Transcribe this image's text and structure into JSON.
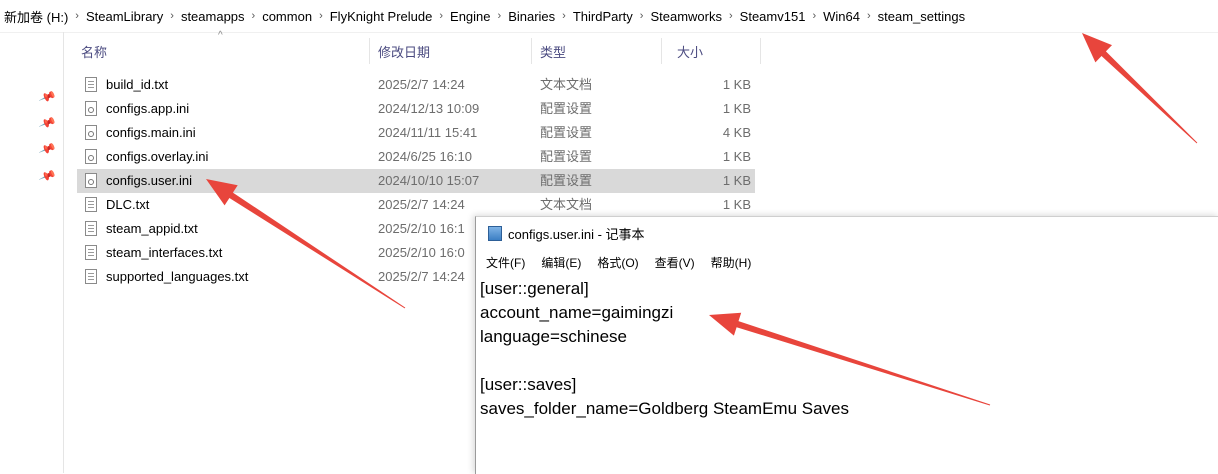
{
  "breadcrumb": [
    "新加卷 (H:)",
    "SteamLibrary",
    "steamapps",
    "common",
    "FlyKnight Prelude",
    "Engine",
    "Binaries",
    "ThirdParty",
    "Steamworks",
    "Steamv151",
    "Win64",
    "steam_settings"
  ],
  "columns": {
    "name": "名称",
    "date": "修改日期",
    "type": "类型",
    "size": "大小"
  },
  "files": [
    {
      "name": "build_id.txt",
      "date": "2025/2/7 14:24",
      "type": "文本文档",
      "size": "1 KB",
      "icon": "text-file-icon"
    },
    {
      "name": "configs.app.ini",
      "date": "2024/12/13 10:09",
      "type": "配置设置",
      "size": "1 KB",
      "icon": "config-file-icon"
    },
    {
      "name": "configs.main.ini",
      "date": "2024/11/11 15:41",
      "type": "配置设置",
      "size": "4 KB",
      "icon": "config-file-icon"
    },
    {
      "name": "configs.overlay.ini",
      "date": "2024/6/25 16:10",
      "type": "配置设置",
      "size": "1 KB",
      "icon": "config-file-icon"
    },
    {
      "name": "configs.user.ini",
      "date": "2024/10/10 15:07",
      "type": "配置设置",
      "size": "1 KB",
      "icon": "config-file-icon",
      "selected": true
    },
    {
      "name": "DLC.txt",
      "date": "2025/2/7 14:24",
      "type": "文本文档",
      "size": "1 KB",
      "icon": "text-file-icon"
    },
    {
      "name": "steam_appid.txt",
      "date": "2025/2/10 16:1",
      "type": "",
      "size": "",
      "icon": "text-file-icon"
    },
    {
      "name": "steam_interfaces.txt",
      "date": "2025/2/10 16:0",
      "type": "",
      "size": "",
      "icon": "text-file-icon"
    },
    {
      "name": "supported_languages.txt",
      "date": "2025/2/7 14:24",
      "type": "",
      "size": "",
      "icon": "text-file-icon"
    }
  ],
  "notepad": {
    "title": "configs.user.ini - 记事本",
    "menu": [
      "文件(F)",
      "编辑(E)",
      "格式(O)",
      "查看(V)",
      "帮助(H)"
    ],
    "lines": [
      "[user::general]",
      "account_name=gaimingzi",
      "language=schinese",
      "",
      "[user::saves]",
      "saves_folder_name=Goldberg SteamEmu Saves"
    ]
  },
  "annotation_color": "#e8453c"
}
